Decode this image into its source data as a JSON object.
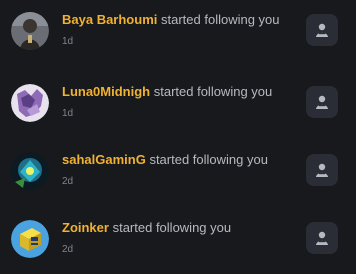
{
  "notifications": [
    {
      "username": "Baya Barhoumi",
      "action": "started following you",
      "time": "1d",
      "avatar_icon": "avatar-figure",
      "action_icon": "user-profile-icon"
    },
    {
      "username": "Luna0Midnigh",
      "action": "started following you",
      "time": "1d",
      "avatar_icon": "avatar-purple-art",
      "action_icon": "user-profile-icon"
    },
    {
      "username": "sahalGaminG",
      "action": "started following you",
      "time": "2d",
      "avatar_icon": "avatar-gaming",
      "action_icon": "user-profile-icon"
    },
    {
      "username": "Zoinker",
      "action": "started following you",
      "time": "2d",
      "avatar_icon": "avatar-cube",
      "action_icon": "user-profile-icon"
    }
  ],
  "colors": {
    "background": "#18191c",
    "username": "#f0b232",
    "action_text": "#b5bac1",
    "timestamp": "#80848e",
    "button_bg": "#2b2d36"
  }
}
